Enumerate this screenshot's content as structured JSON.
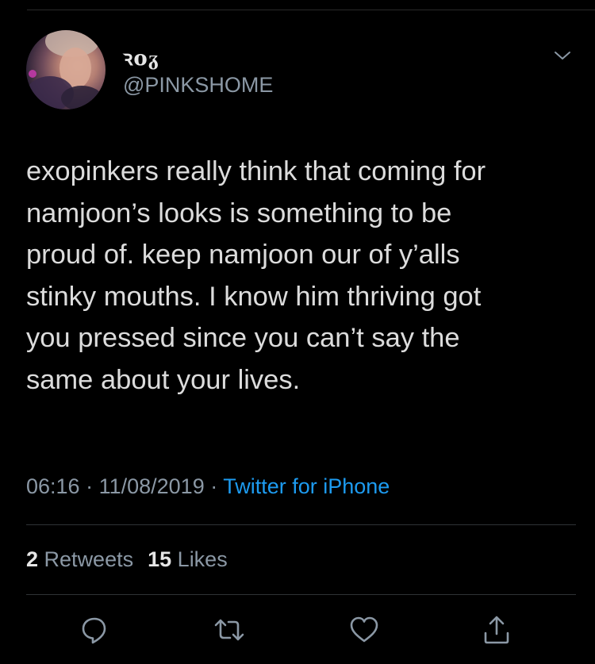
{
  "tweet": {
    "display_name": "ꝛoᵹ",
    "handle": "@PINKSHOME",
    "text": "exopinkers really think that coming for\nnamjoon’s looks is something to be\nproud of. keep namjoon our of y’alls\nstinky mouths. I know him thriving got\nyou pressed since you can’t say the\nsame about your lives.",
    "time": "06:16",
    "date": "11/08/2019",
    "separator": " · ",
    "source": "Twitter for iPhone",
    "retweets_count": "2",
    "retweets_label": "Retweets",
    "likes_count": "15",
    "likes_label": "Likes"
  },
  "icons": {
    "more": "chevron-down-icon",
    "reply": "reply-icon",
    "retweet": "retweet-icon",
    "like": "heart-icon",
    "share": "share-icon"
  },
  "colors": {
    "background": "#000000",
    "text": "#dcdcdc",
    "secondary": "#8b98a5",
    "link": "#1d9bf0",
    "divider": "#2f3336"
  }
}
